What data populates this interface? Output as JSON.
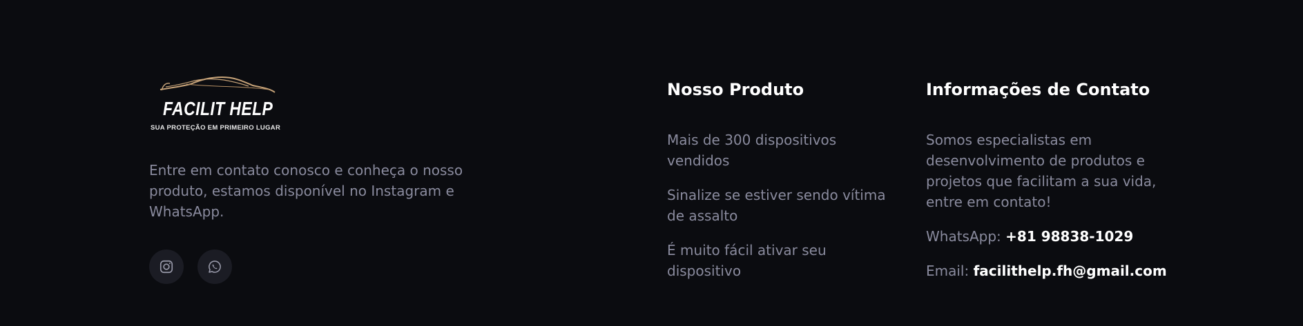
{
  "brand": {
    "logo_name": "FACILIT HELP",
    "logo_tagline": "SUA PROTEÇÃO EM PRIMEIRO LUGAR",
    "description": "Entre em contato conosco e conheça o nosso produto, estamos disponível no Instagram e WhatsApp.",
    "socials": [
      {
        "icon": "instagram-icon"
      },
      {
        "icon": "whatsapp-icon"
      }
    ]
  },
  "product": {
    "title": "Nosso Produto",
    "items": [
      "Mais de 300 dispositivos vendidos",
      "Sinalize se estiver sendo vítima de assalto",
      "É muito fácil ativar seu dispositivo"
    ]
  },
  "contact": {
    "title": "Informações de Contato",
    "description": "Somos especialistas em desenvolvimento de produtos e projetos que facilitam a sua vida, entre em contato!",
    "whatsapp_label": "WhatsApp:",
    "whatsapp_value": "+81 98838-1029",
    "email_label": "Email:",
    "email_value": "facilithelp.fh@gmail.com"
  },
  "colors": {
    "background": "#0b0c10",
    "text_muted": "#8a8b9e",
    "text_heading": "#ffffff",
    "social_bg": "#1b1c24",
    "logo_accent": "#c9a57a"
  }
}
